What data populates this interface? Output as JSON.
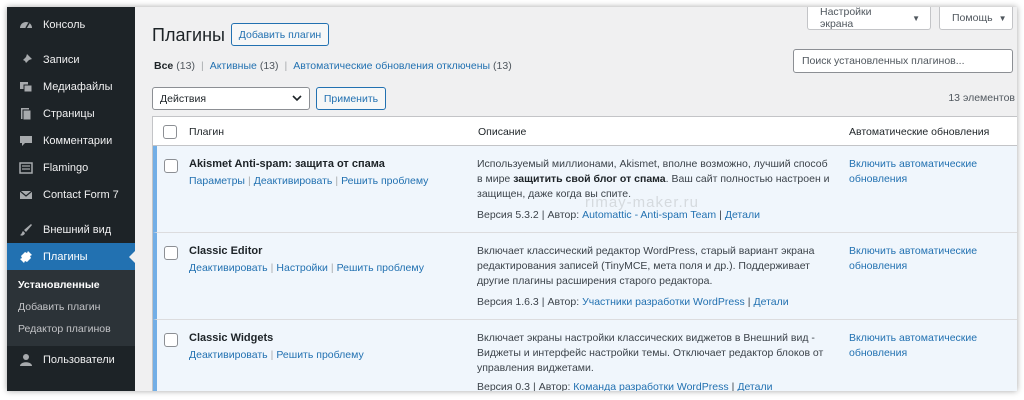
{
  "sidebar": {
    "items": [
      {
        "label": "Консоль",
        "icon": "dashboard-icon"
      },
      {
        "label": "Записи",
        "icon": "pin-icon"
      },
      {
        "label": "Медиафайлы",
        "icon": "media-icon"
      },
      {
        "label": "Страницы",
        "icon": "pages-icon"
      },
      {
        "label": "Комментарии",
        "icon": "comments-icon"
      },
      {
        "label": "Flamingo",
        "icon": "flamingo-icon"
      },
      {
        "label": "Contact Form 7",
        "icon": "mail-icon"
      },
      {
        "label": "Внешний вид",
        "icon": "brush-icon"
      },
      {
        "label": "Плагины",
        "icon": "plugin-icon"
      },
      {
        "label": "Пользователи",
        "icon": "user-icon"
      }
    ],
    "submenu": [
      "Установленные",
      "Добавить плагин",
      "Редактор плагинов"
    ]
  },
  "header": {
    "title": "Плагины",
    "add_plugin": "Добавить плагин",
    "screen_options": "Настройки экрана",
    "help": "Помощь"
  },
  "filters": {
    "all_label": "Все",
    "all_count": "(13)",
    "active_label": "Активные",
    "active_count": "(13)",
    "autoupdates_label": "Автоматические обновления отключены",
    "autoupdates_count": "(13)"
  },
  "search": {
    "placeholder": "Поиск установленных плагинов..."
  },
  "bulk": {
    "selected": "Действия",
    "apply": "Применить"
  },
  "items_count": "13 элементов",
  "table": {
    "columns": {
      "plugin": "Плагин",
      "description": "Описание",
      "auto": "Автоматические обновления"
    },
    "rows": [
      {
        "name": "Akismet Anti-spam: защита от спама",
        "actions": [
          "Параметры",
          "Деактивировать",
          "Решить проблему"
        ],
        "desc_pre": "Используемый миллионами, Akismet, вполне возможно, лучший способ в мире ",
        "desc_bold": "защитить свой блог от спама",
        "desc_post": ". Ваш сайт полностью настроен и защищен, даже когда вы спите.",
        "version": "Версия 5.3.2",
        "author_label": "Автор:",
        "author": "Automattic - Anti-spam Team",
        "details": "Детали",
        "auto": "Включить автоматические обновления"
      },
      {
        "name": "Classic Editor",
        "actions": [
          "Деактивировать",
          "Настройки",
          "Решить проблему"
        ],
        "desc_pre": "Включает классический редактор WordPress, старый вариант экрана редактирования записей (TinyMCE, мета поля и др.). Поддерживает другие плагины расширения старого редактора.",
        "desc_bold": "",
        "desc_post": "",
        "version": "Версия 1.6.3",
        "author_label": "Автор:",
        "author": "Участники разработки WordPress",
        "details": "Детали",
        "auto": "Включить автоматические обновления"
      },
      {
        "name": "Classic Widgets",
        "actions": [
          "Деактивировать",
          "Решить проблему"
        ],
        "desc_pre": "Включает экраны настройки классических виджетов в Внешний вид - Виджеты и интерфейс настройки темы. Отключает редактор блоков от управления виджетами.",
        "desc_bold": "",
        "desc_post": "",
        "version": "Версия 0.3",
        "author_label": "Автор:",
        "author": "Команда разработки WordPress",
        "details": "Детали",
        "auto": "Включить автоматические обновления"
      }
    ]
  },
  "watermark": "rimay-maker.ru",
  "colors": {
    "sidebar_bg": "#1d2327",
    "accent": "#2271b1",
    "active_row": "#f0f6fc"
  }
}
